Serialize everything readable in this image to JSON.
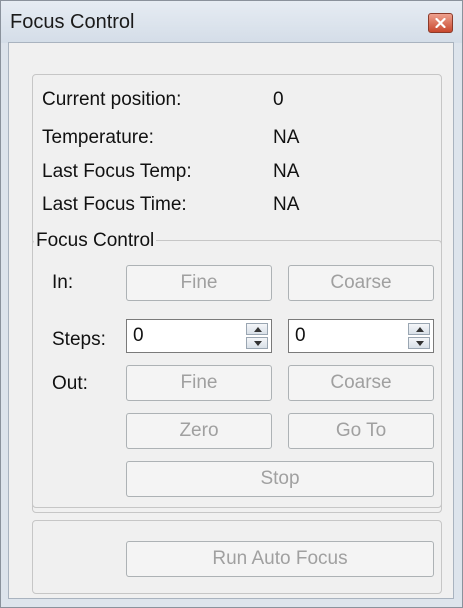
{
  "window": {
    "title": "Focus Control"
  },
  "info": [
    {
      "label": "Current position:",
      "value": "0"
    },
    {
      "label": "Temperature:",
      "value": "NA"
    },
    {
      "label": "Last Focus Temp:",
      "value": "NA"
    },
    {
      "label": "Last Focus Time:",
      "value": "NA"
    }
  ],
  "focus_control": {
    "title": "Focus Control",
    "in_label": "In:",
    "steps_label": "Steps:",
    "out_label": "Out:",
    "in_fine": "Fine",
    "in_coarse": "Coarse",
    "steps_fine_value": "0",
    "steps_coarse_value": "0",
    "out_fine": "Fine",
    "out_coarse": "Coarse",
    "zero": "Zero",
    "goto": "Go To",
    "stop": "Stop"
  },
  "auto_focus": {
    "run_label": "Run Auto Focus"
  }
}
